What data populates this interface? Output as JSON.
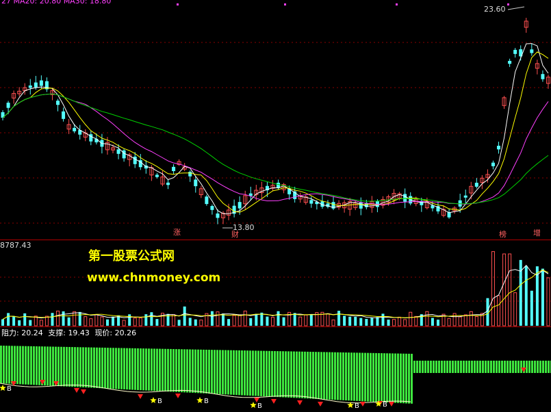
{
  "colors": {
    "up": "#ff5050",
    "down": "#54ffff",
    "ma_white": "#ffffff",
    "ma_yellow": "#ffff00",
    "ma_magenta": "#ff40ff",
    "ma_green": "#00d000",
    "divider": "#b00000",
    "green_bar": "#3ee63e"
  },
  "top_header": {
    "text": "27  MA20: 20.80  MA30: 18.80"
  },
  "price_panel": {
    "high_label": "23.60",
    "low_label": "13.80",
    "markers": [
      "涨",
      "财",
      "榜",
      "增"
    ]
  },
  "volume_panel": {
    "header": "8787.43"
  },
  "watermark": {
    "line1": "第一股票公式网",
    "line2": "www.chnmoney.com"
  },
  "indicator_panel": {
    "resistance_label": "阻力:",
    "resistance_value": "20.24",
    "support_label": "支撑:",
    "support_value": "19.43",
    "price_label": "现价:",
    "price_value": "20.26",
    "signal_letter": "B"
  },
  "chart_data": {
    "type": "candlestick",
    "price_high": 23.6,
    "price_low": 13.8,
    "candles_count": 100
  }
}
